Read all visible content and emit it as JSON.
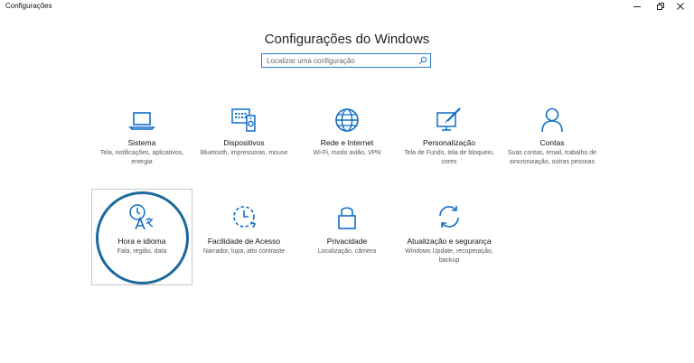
{
  "window": {
    "title": "Configurações",
    "controls": [
      "minimize-icon",
      "maximize-icon",
      "close-icon"
    ]
  },
  "heading": "Configurações do Windows",
  "search": {
    "placeholder": "Localizar uma configuração",
    "value": "",
    "icon": "search-icon"
  },
  "accent_color": "#0f6dc7",
  "focus_ring_color": "#1b6a9b",
  "categories": [
    {
      "label": "Sistema",
      "description": "Tela, notificações, aplicativos, energia",
      "icon": "laptop-icon"
    },
    {
      "label": "Dispositivos",
      "description": "Bluetooth, impressoras, mouse",
      "icon": "devices-icon"
    },
    {
      "label": "Rede e Internet",
      "description": "Wi-Fi, modo avião, VPN",
      "icon": "globe-icon"
    },
    {
      "label": "Personalização",
      "description": "Tela de Fundo, tela de bloqueio, cores",
      "icon": "personalization-icon"
    },
    {
      "label": "Contas",
      "description": "Suas contas, email, trabalho de sincronização, outras pessoas",
      "icon": "person-icon"
    },
    {
      "label": "Hora e idioma",
      "description": "Fala, região, data",
      "icon": "time-language-icon"
    },
    {
      "label": "Facilidade de Acesso",
      "description": "Narrador, lupa, alto contraste",
      "icon": "ease-of-access-icon"
    },
    {
      "label": "Privacidade",
      "description": "Localização, câmera",
      "icon": "lock-icon"
    },
    {
      "label": "Atualização e segurança",
      "description": "Windows Update, recuperação, backup",
      "icon": "update-icon"
    }
  ]
}
